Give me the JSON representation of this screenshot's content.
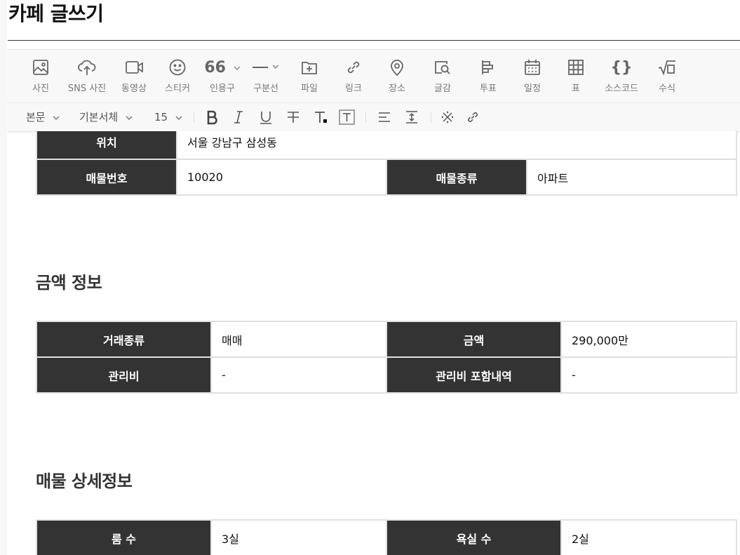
{
  "page_title": "카페 글쓰기",
  "toolbar": {
    "tools": [
      {
        "icon": "photo-icon",
        "label": "사진"
      },
      {
        "icon": "cloud-upload-icon",
        "label": "SNS 사진"
      },
      {
        "icon": "video-icon",
        "label": "동영상"
      },
      {
        "icon": "smiley-icon",
        "label": "스티커"
      },
      {
        "icon": "quote-icon",
        "label": "인용구"
      },
      {
        "icon": "divider-line-icon",
        "label": "구분선"
      },
      {
        "icon": "file-add-icon",
        "label": "파일"
      },
      {
        "icon": "link-icon",
        "label": "링크"
      },
      {
        "icon": "map-pin-icon",
        "label": "장소"
      },
      {
        "icon": "search-material-icon",
        "label": "글감"
      },
      {
        "icon": "vote-icon",
        "label": "투표"
      },
      {
        "icon": "calendar-icon",
        "label": "일정"
      },
      {
        "icon": "table-grid-icon",
        "label": "표"
      },
      {
        "icon": "braces-icon",
        "label": "소스코드"
      },
      {
        "icon": "sqrt-formula-icon",
        "label": "수식"
      }
    ],
    "quote_glyph": "66",
    "format": {
      "paragraph_style": "본문",
      "font_family": "기본서체",
      "font_size": "15"
    }
  },
  "content": {
    "table_location": {
      "rows": [
        [
          {
            "label": "위치",
            "value": "서울 강남구 삼성동"
          }
        ],
        [
          {
            "label": "매물번호",
            "value": "10020"
          },
          {
            "label": "매물종류",
            "value": "아파트"
          }
        ]
      ]
    },
    "section_price": {
      "title": "금액 정보",
      "rows": [
        [
          {
            "label": "거래종류",
            "value": "매매"
          },
          {
            "label": "금액",
            "value": "290,000만"
          }
        ],
        [
          {
            "label": "관리비",
            "value": "-"
          },
          {
            "label": "관리비 포함내역",
            "value": "-"
          }
        ]
      ]
    },
    "section_detail": {
      "title": "매물 상세정보",
      "rows": [
        [
          {
            "label": "룸 수",
            "value": "3실"
          },
          {
            "label": "욕실 수",
            "value": "2실"
          }
        ]
      ]
    }
  }
}
